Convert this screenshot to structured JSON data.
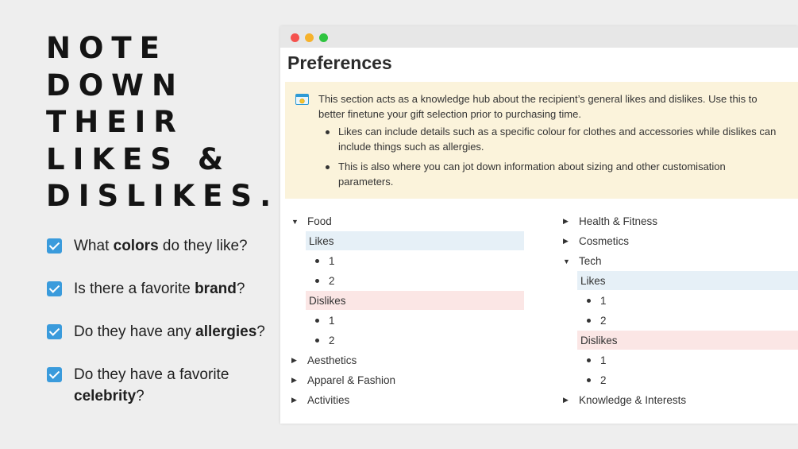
{
  "headline": {
    "lines": [
      "NOTE",
      "DOWN",
      "THEIR",
      "LIKES &",
      "DISLIKES."
    ]
  },
  "checklist": [
    {
      "before": "What ",
      "bold": "colors",
      "after": " do they like?",
      "checked": true
    },
    {
      "before": "Is there a favorite ",
      "bold": "brand",
      "after": "?",
      "checked": true
    },
    {
      "before": "Do they have any ",
      "bold": "allergies",
      "after": "?",
      "checked": true
    },
    {
      "before": "Do they have a favorite ",
      "bold": "celebrity",
      "after": "?",
      "checked": true
    }
  ],
  "window": {
    "title": "Preferences",
    "callout": {
      "icon": "info-card-icon",
      "text": "This section acts as a knowledge hub about the recipient’s general likes and dislikes. Use this to better finetune your gift selection prior to purchasing time.",
      "bullets": [
        "Likes can include details such as a specific colour for clothes and accessories while dislikes can include things such as allergies.",
        "This is also where you can jot down information about sizing and other customisation parameters."
      ]
    },
    "left_column": {
      "food": {
        "label": "Food",
        "likes_label": "Likes",
        "likes": [
          "1",
          "2"
        ],
        "dislikes_label": "Dislikes",
        "dislikes": [
          "1",
          "2"
        ]
      },
      "collapsed": [
        "Aesthetics",
        "Apparel & Fashion",
        "Activities"
      ]
    },
    "right_column": {
      "collapsed_top": [
        "Health & Fitness",
        "Cosmetics"
      ],
      "tech": {
        "label": "Tech",
        "likes_label": "Likes",
        "likes": [
          "1",
          "2"
        ],
        "dislikes_label": "Dislikes",
        "dislikes": [
          "1",
          "2"
        ]
      },
      "collapsed_bottom": [
        "Knowledge & Interests"
      ]
    }
  },
  "colors": {
    "accent": "#3a9bdc",
    "callout_bg": "#fbf3db",
    "likes_bg": "#e6f0f7",
    "dislikes_bg": "#fbe6e5"
  }
}
